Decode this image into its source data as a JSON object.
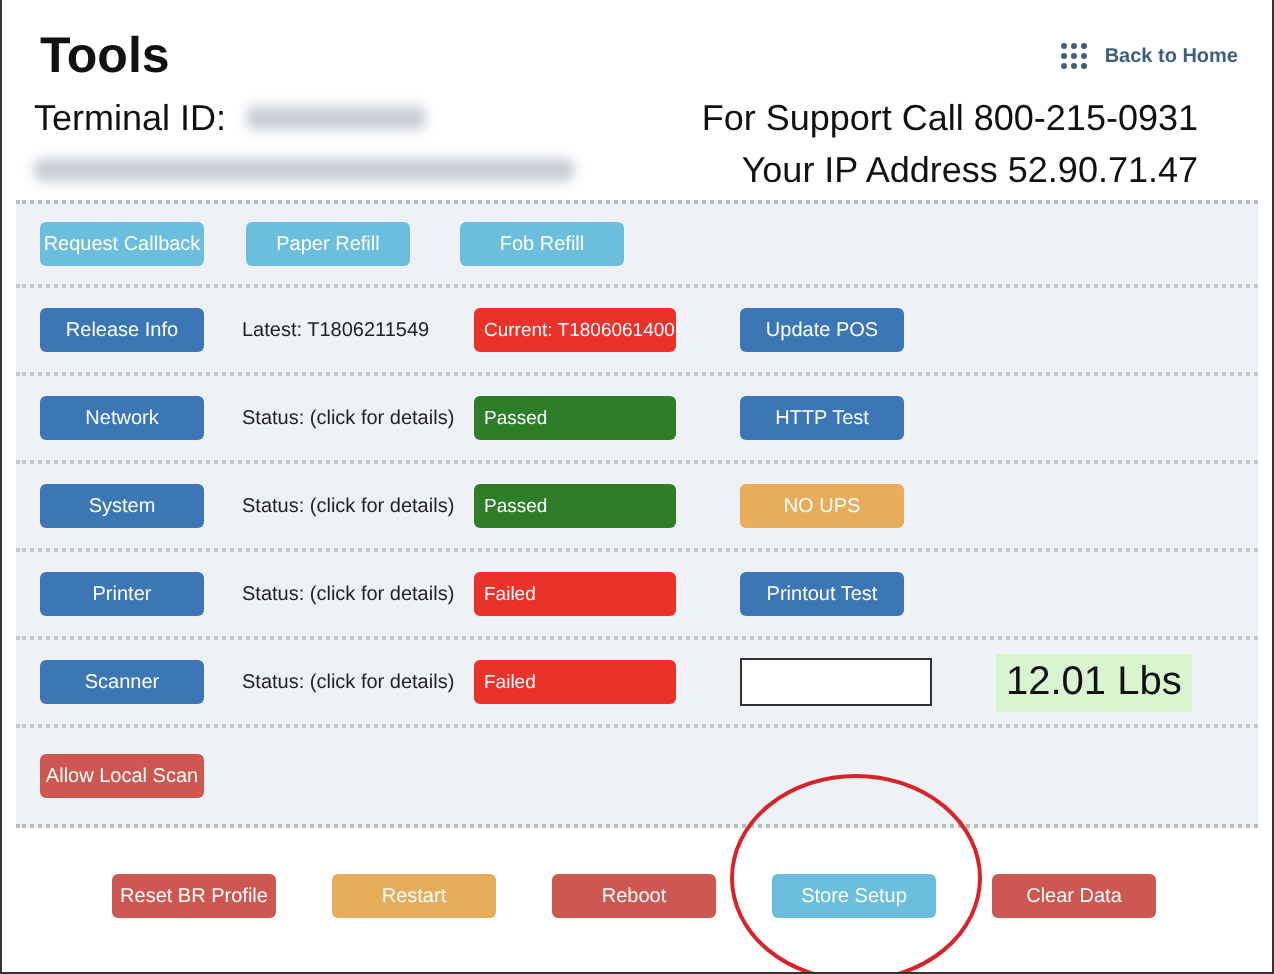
{
  "header": {
    "title": "Tools",
    "back_link": "Back to Home"
  },
  "info": {
    "terminal_label": "Terminal ID:",
    "support": "For Support Call 800-215-0931",
    "ip": "Your IP Address 52.90.71.47"
  },
  "toolbar": [
    {
      "label": "Request Callback",
      "color": "#6bbfdc"
    },
    {
      "label": "Paper Refill",
      "color": "#6bbfdc"
    },
    {
      "label": "Fob Refill",
      "color": "#6bbfdc"
    }
  ],
  "rows": [
    {
      "button": {
        "label": "Release Info",
        "color": "#3c76b5"
      },
      "info": "Latest: T1806211549",
      "status": {
        "label": "Current: T1806061400",
        "color": "#e8322a"
      },
      "action": {
        "kind": "button",
        "label": "Update POS",
        "color": "#3c76b5"
      }
    },
    {
      "button": {
        "label": "Network",
        "color": "#3c76b5"
      },
      "info": "Status: (click for details)",
      "status": {
        "label": "Passed",
        "color": "#2e7d28"
      },
      "action": {
        "kind": "button",
        "label": "HTTP Test",
        "color": "#3c76b5"
      }
    },
    {
      "button": {
        "label": "System",
        "color": "#3c76b5"
      },
      "info": "Status: (click for details)",
      "status": {
        "label": "Passed",
        "color": "#2e7d28"
      },
      "action": {
        "kind": "button",
        "label": "NO UPS",
        "color": "#e7ad5b"
      }
    },
    {
      "button": {
        "label": "Printer",
        "color": "#3c76b5"
      },
      "info": "Status: (click for details)",
      "status": {
        "label": "Failed",
        "color": "#e8322a"
      },
      "action": {
        "kind": "button",
        "label": "Printout Test",
        "color": "#3c76b5"
      }
    },
    {
      "button": {
        "label": "Scanner",
        "color": "#3c76b5"
      },
      "info": "Status: (click for details)",
      "status": {
        "label": "Failed",
        "color": "#e8322a"
      },
      "action": {
        "kind": "field"
      },
      "reading": "12.01 Lbs"
    }
  ],
  "extra": [
    {
      "label": "Allow Local Scan",
      "color": "#cf5752"
    }
  ],
  "footer": [
    {
      "label": "Reset BR Profile",
      "color": "#cf5752",
      "circled": false
    },
    {
      "label": "Restart",
      "color": "#e7ad5b",
      "circled": false
    },
    {
      "label": "Reboot",
      "color": "#cf5752",
      "circled": false
    },
    {
      "label": "Store Setup",
      "color": "#6bbfdc",
      "circled": true
    },
    {
      "label": "Clear Data",
      "color": "#cf5752",
      "circled": false
    }
  ]
}
